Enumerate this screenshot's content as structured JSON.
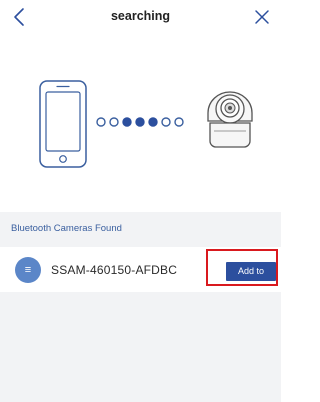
{
  "header": {
    "title": "searching",
    "back_icon": "chevron-left-icon",
    "close_icon": "close-icon"
  },
  "illustration": {
    "phone_icon": "smartphone-icon",
    "camera_icon": "camera-icon",
    "dots": 7,
    "filled_dots": 3
  },
  "section": {
    "title": "Bluetooth Cameras Found"
  },
  "devices": [
    {
      "name": "SSAM-460150-AFDBC",
      "avatar_glyph": "≡",
      "add_label": "Add to"
    }
  ],
  "colors": {
    "accent": "#2c4f9e",
    "section_text": "#3a5f9f",
    "highlight": "#d9191e",
    "avatar": "#5b86c8"
  }
}
